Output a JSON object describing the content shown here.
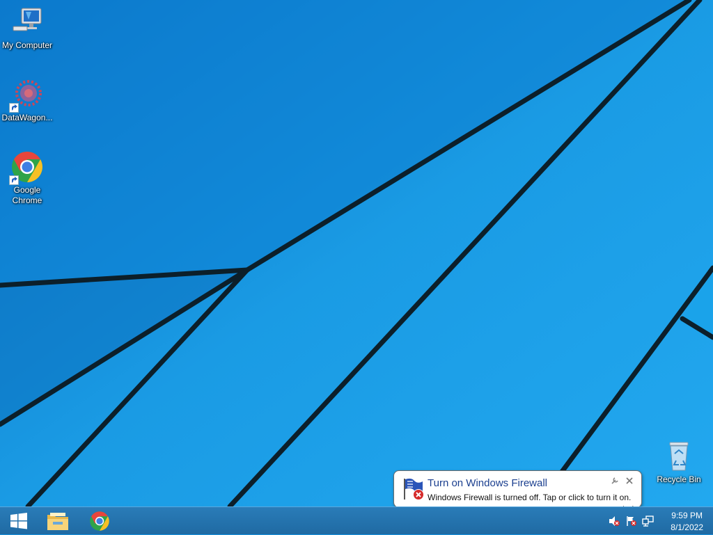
{
  "desktop": {
    "icons": [
      {
        "label": "My Computer",
        "icon": "computer-icon"
      },
      {
        "label": "DataWagon...",
        "icon": "gear-shortcut-icon"
      },
      {
        "label": "Google Chrome",
        "icon": "chrome-icon"
      },
      {
        "label": "Recycle Bin",
        "icon": "recycle-bin-icon"
      }
    ]
  },
  "notification": {
    "title": "Turn on Windows Firewall",
    "message": "Windows Firewall is turned off. Tap or click to turn it on.",
    "icon": "firewall-flag-icon"
  },
  "taskbar": {
    "pinned": [
      "windows-start-icon",
      "file-explorer-icon",
      "chrome-icon"
    ],
    "tray": [
      "volume-muted-icon",
      "action-center-flag-icon",
      "network-icon"
    ],
    "clock": {
      "time": "9:59 PM",
      "date": "8/1/2022"
    }
  },
  "colors": {
    "wallpaper": "#1692dd",
    "taskbar": "#2272ad",
    "balloon_title": "#1b3f8f"
  }
}
